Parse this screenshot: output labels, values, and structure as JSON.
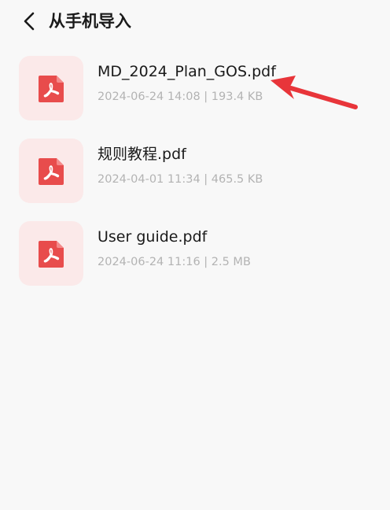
{
  "header": {
    "title": "从手机导入",
    "back_icon": "chevron-left-icon"
  },
  "files": [
    {
      "name": "MD_2024_Plan_GOS.pdf",
      "meta": "2024-06-24 14:08 | 193.4 KB",
      "icon": "pdf-file-icon"
    },
    {
      "name": "规则教程.pdf",
      "meta": "2024-04-01 11:34 | 465.5 KB",
      "icon": "pdf-file-icon"
    },
    {
      "name": "User guide.pdf",
      "meta": "2024-06-24 11:16 | 2.5 MB",
      "icon": "pdf-file-icon"
    }
  ],
  "colors": {
    "background": "#f8f8f8",
    "thumb_background": "#fbe9e9",
    "pdf_red": "#e84c4c",
    "annotation_arrow": "#e8353a",
    "meta_text": "#b3b3b3",
    "primary_text": "#1a1a1a"
  },
  "annotation": {
    "type": "arrow",
    "icon": "red-arrow-icon",
    "points_to": "files.0"
  }
}
